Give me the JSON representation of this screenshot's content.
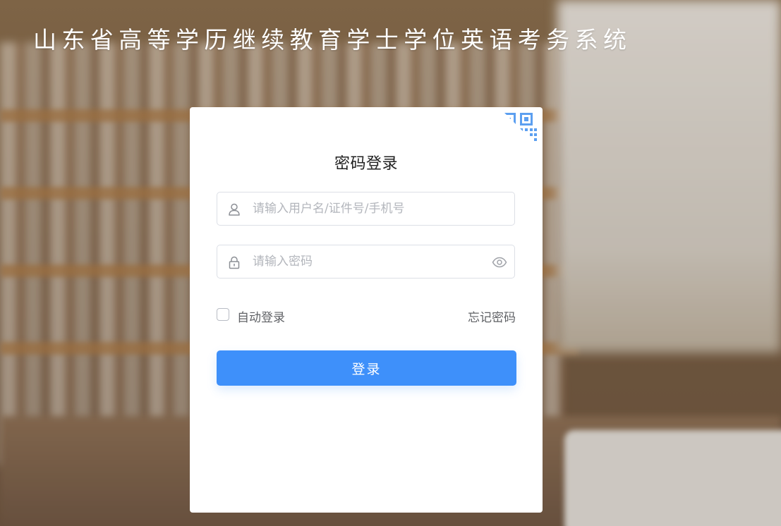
{
  "site": {
    "title": "山东省高等学历继续教育学士学位英语考务系统"
  },
  "login": {
    "title": "密码登录",
    "username_placeholder": "请输入用户名/证件号/手机号",
    "username_value": "",
    "password_placeholder": "请输入密码",
    "password_value": "",
    "auto_login_label": "自动登录",
    "auto_login_checked": false,
    "forgot_label": "忘记密码",
    "submit_label": "登录"
  },
  "icons": {
    "qr_switch": "qrcode-icon",
    "username": "user-icon",
    "password": "lock-icon",
    "toggle_password": "eye-icon"
  },
  "colors": {
    "primary": "#3e90fa",
    "qr_icon": "#5c9ff0",
    "placeholder": "#b3b6bc",
    "text_secondary": "#606266"
  }
}
